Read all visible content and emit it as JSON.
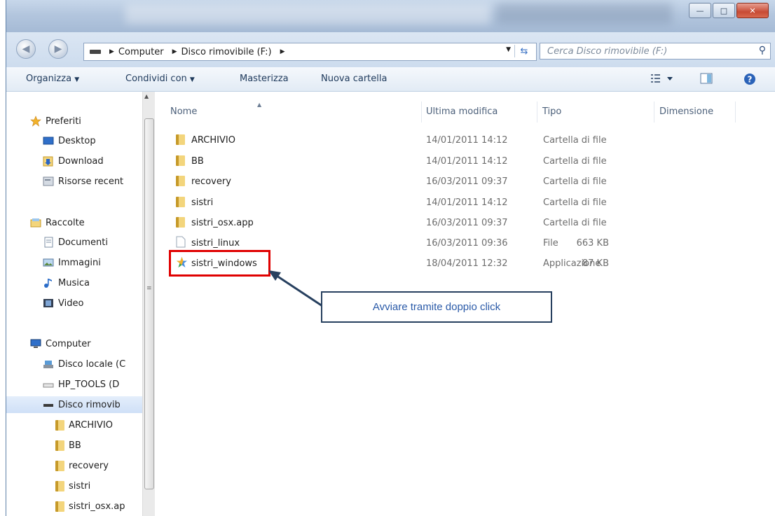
{
  "address": {
    "crumbs": [
      "Computer",
      "Disco rimovibile (F:)"
    ]
  },
  "search": {
    "placeholder": "Cerca Disco rimovibile (F:)"
  },
  "toolbar": {
    "organize": "Organizza",
    "share": "Condividi con",
    "burn": "Masterizza",
    "new_folder": "Nuova cartella"
  },
  "sidebar": {
    "favorites": "Preferiti",
    "desktop": "Desktop",
    "download": "Download",
    "recent": "Risorse recent",
    "libraries": "Raccolte",
    "documents": "Documenti",
    "pictures": "Immagini",
    "music": "Musica",
    "video": "Video",
    "computer": "Computer",
    "local_disk": "Disco locale (C",
    "hp_tools": "HP_TOOLS (D",
    "removable": "Disco rimovib",
    "subfolders": [
      "ARCHIVIO",
      "BB",
      "recovery",
      "sistri",
      "sistri_osx.ap"
    ]
  },
  "columns": {
    "name": "Nome",
    "modified": "Ultima modifica",
    "type": "Tipo",
    "size": "Dimensione"
  },
  "files": [
    {
      "name": "ARCHIVIO",
      "modified": "14/01/2011 14:12",
      "type": "Cartella di file",
      "size": "",
      "icon": "folder-icon"
    },
    {
      "name": "BB",
      "modified": "14/01/2011 14:12",
      "type": "Cartella di file",
      "size": "",
      "icon": "folder-icon"
    },
    {
      "name": "recovery",
      "modified": "16/03/2011 09:37",
      "type": "Cartella di file",
      "size": "",
      "icon": "folder-icon"
    },
    {
      "name": "sistri",
      "modified": "14/01/2011 14:12",
      "type": "Cartella di file",
      "size": "",
      "icon": "folder-icon"
    },
    {
      "name": "sistri_osx.app",
      "modified": "16/03/2011 09:37",
      "type": "Cartella di file",
      "size": "",
      "icon": "folder-icon"
    },
    {
      "name": "sistri_linux",
      "modified": "16/03/2011 09:36",
      "type": "File",
      "size": "663 KB",
      "icon": "file-icon"
    },
    {
      "name": "sistri_windows",
      "modified": "18/04/2011 12:32",
      "type": "Applicazione",
      "size": "87 KB",
      "icon": "app-icon"
    }
  ],
  "callout": {
    "text": "Avviare tramite doppio click"
  },
  "colors": {
    "highlight": "#e00000",
    "callout_border": "#27405f",
    "callout_text": "#2a5aa8"
  }
}
